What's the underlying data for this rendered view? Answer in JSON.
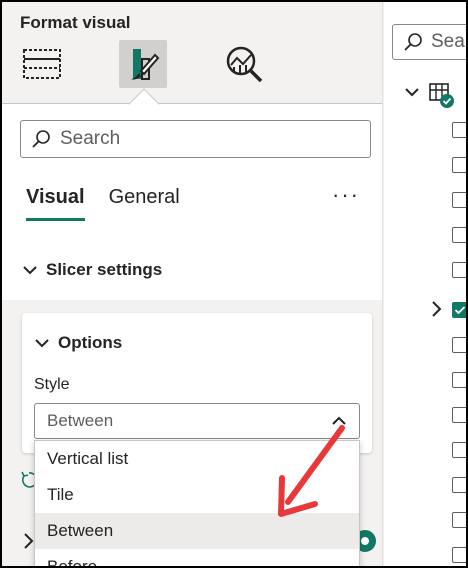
{
  "pane": {
    "title": "Format visual",
    "toolbar": [
      {
        "name": "build-visual-icon",
        "active": false
      },
      {
        "name": "format-visual-icon",
        "active": true
      },
      {
        "name": "analytics-icon",
        "active": false
      }
    ],
    "search_placeholder": "Search",
    "tabs": [
      {
        "label": "Visual",
        "active": true
      },
      {
        "label": "General",
        "active": false
      }
    ],
    "more_label": "···",
    "section": {
      "label": "Slicer settings"
    },
    "options_card": {
      "title": "Options",
      "style_label": "Style",
      "selected_value": "Between",
      "dropdown_options": [
        "Vertical list",
        "Tile",
        "Between",
        "Before"
      ],
      "highlighted_option": "Between"
    }
  },
  "data_pane": {
    "search_placeholder": "Sea"
  },
  "colors": {
    "accent": "#117865",
    "arrow": "#e8393a"
  }
}
